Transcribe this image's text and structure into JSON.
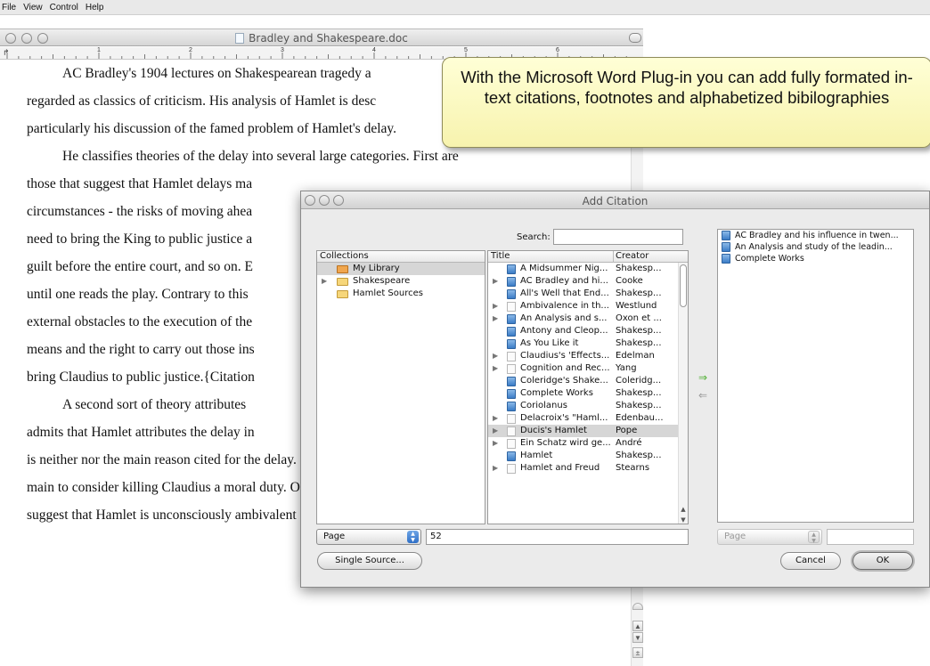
{
  "menubar": {
    "items": [
      "File",
      "View",
      "Control",
      "Help"
    ]
  },
  "document": {
    "window_title": "Bradley and Shakespeare.doc",
    "ruler_numbers": [
      "1",
      "2",
      "3",
      "4",
      "5",
      "6"
    ],
    "lines": [
      {
        "text": "AC Bradley's 1904 lectures on Shakespearean tragedy a",
        "indent": true
      },
      {
        "text": "regarded as classics of criticism. His analysis of Hamlet is desc",
        "indent": false
      },
      {
        "text": "particularly his discussion of the famed problem of Hamlet's delay.",
        "indent": false
      },
      {
        "text": "He classifies theories of the delay into several large categories. First are",
        "indent": true
      },
      {
        "text": "those that suggest that Hamlet delays ma",
        "indent": false
      },
      {
        "text": "circumstances - the risks of moving ahea",
        "indent": false
      },
      {
        "text": "need to bring the King to public justice a",
        "indent": false
      },
      {
        "text": "guilt before the entire court, and so on. E",
        "indent": false
      },
      {
        "text": "until one reads the play. Contrary to this",
        "indent": false
      },
      {
        "text": "external obstacles to the execution of the",
        "indent": false
      },
      {
        "text": "means and the right to carry out those ins",
        "indent": false
      },
      {
        "text": "bring Claudius to public justice.{Citation",
        "indent": false
      },
      {
        "text": "A second sort of theory attributes",
        "indent": true
      },
      {
        "text": "admits that Hamlet attributes the delay in",
        "indent": false
      },
      {
        "text": "is neither nor the main reason cited for the delay. Further, Hamlet appears in the",
        "indent": false
      },
      {
        "text": "main to consider killing Claudius a moral duty. One might shift the ground a bit to",
        "indent": false
      },
      {
        "text": "suggest that Hamlet is unconsciously ambivalent about this duty: \"in the depths of",
        "indent": false
      }
    ]
  },
  "callout": {
    "text": "With the Microsoft Word Plug-in you can add fully formated in-text citations, footnotes and alphabetized bibilographies"
  },
  "dialog": {
    "title": "Add Citation",
    "search_label": "Search:",
    "search_value": "",
    "collections_header": "Collections",
    "collections": [
      {
        "label": "My Library",
        "expandable": false,
        "selected": true,
        "folder": "orange"
      },
      {
        "label": "Shakespeare",
        "expandable": true,
        "selected": false,
        "folder": "yellow"
      },
      {
        "label": "Hamlet Sources",
        "expandable": false,
        "selected": false,
        "folder": "yellow"
      }
    ],
    "items_header": {
      "title": "Title",
      "creator": "Creator"
    },
    "items": [
      {
        "title": "A Midsummer Nig...",
        "creator": "Shakesp...",
        "expandable": false,
        "type": "book",
        "selected": false
      },
      {
        "title": "AC Bradley and hi...",
        "creator": "Cooke",
        "expandable": true,
        "type": "book",
        "selected": false
      },
      {
        "title": "All's Well that End...",
        "creator": "Shakesp...",
        "expandable": false,
        "type": "book",
        "selected": false
      },
      {
        "title": "Ambivalence in th...",
        "creator": "Westlund",
        "expandable": true,
        "type": "doc",
        "selected": false
      },
      {
        "title": "An Analysis and s...",
        "creator": "Oxon et ...",
        "expandable": true,
        "type": "book",
        "selected": false
      },
      {
        "title": "Antony and Cleop...",
        "creator": "Shakesp...",
        "expandable": false,
        "type": "book",
        "selected": false
      },
      {
        "title": "As You Like it",
        "creator": "Shakesp...",
        "expandable": false,
        "type": "book",
        "selected": false
      },
      {
        "title": "Claudius's 'Effects...",
        "creator": "Edelman",
        "expandable": true,
        "type": "doc",
        "selected": false
      },
      {
        "title": "Cognition and Rec...",
        "creator": "Yang",
        "expandable": true,
        "type": "doc",
        "selected": false
      },
      {
        "title": "Coleridge's Shake...",
        "creator": "Coleridg...",
        "expandable": false,
        "type": "book",
        "selected": false
      },
      {
        "title": "Complete Works",
        "creator": "Shakesp...",
        "expandable": false,
        "type": "book",
        "selected": false
      },
      {
        "title": "Coriolanus",
        "creator": "Shakesp...",
        "expandable": false,
        "type": "book",
        "selected": false
      },
      {
        "title": "Delacroix's \"Haml...",
        "creator": "Edenbau...",
        "expandable": true,
        "type": "doc",
        "selected": false
      },
      {
        "title": "Ducis's Hamlet",
        "creator": "Pope",
        "expandable": true,
        "type": "doc",
        "selected": true
      },
      {
        "title": "Ein Schatz wird ge...",
        "creator": "André",
        "expandable": true,
        "type": "doc",
        "selected": false
      },
      {
        "title": "Hamlet",
        "creator": "Shakesp...",
        "expandable": false,
        "type": "book",
        "selected": false
      },
      {
        "title": "Hamlet and Freud",
        "creator": "Stearns",
        "expandable": true,
        "type": "doc",
        "selected": false
      }
    ],
    "move_right_icon": "arrow-right-icon",
    "move_left_icon": "arrow-left-icon",
    "selected_items": [
      "AC Bradley and his influence in twen...",
      "An Analysis and study of the leadin...",
      "Complete Works"
    ],
    "locator_left": {
      "label": "Page",
      "value": "52"
    },
    "locator_right": {
      "label": "Page",
      "value": ""
    },
    "single_source_label": "Single Source...",
    "cancel_label": "Cancel",
    "ok_label": "OK"
  }
}
